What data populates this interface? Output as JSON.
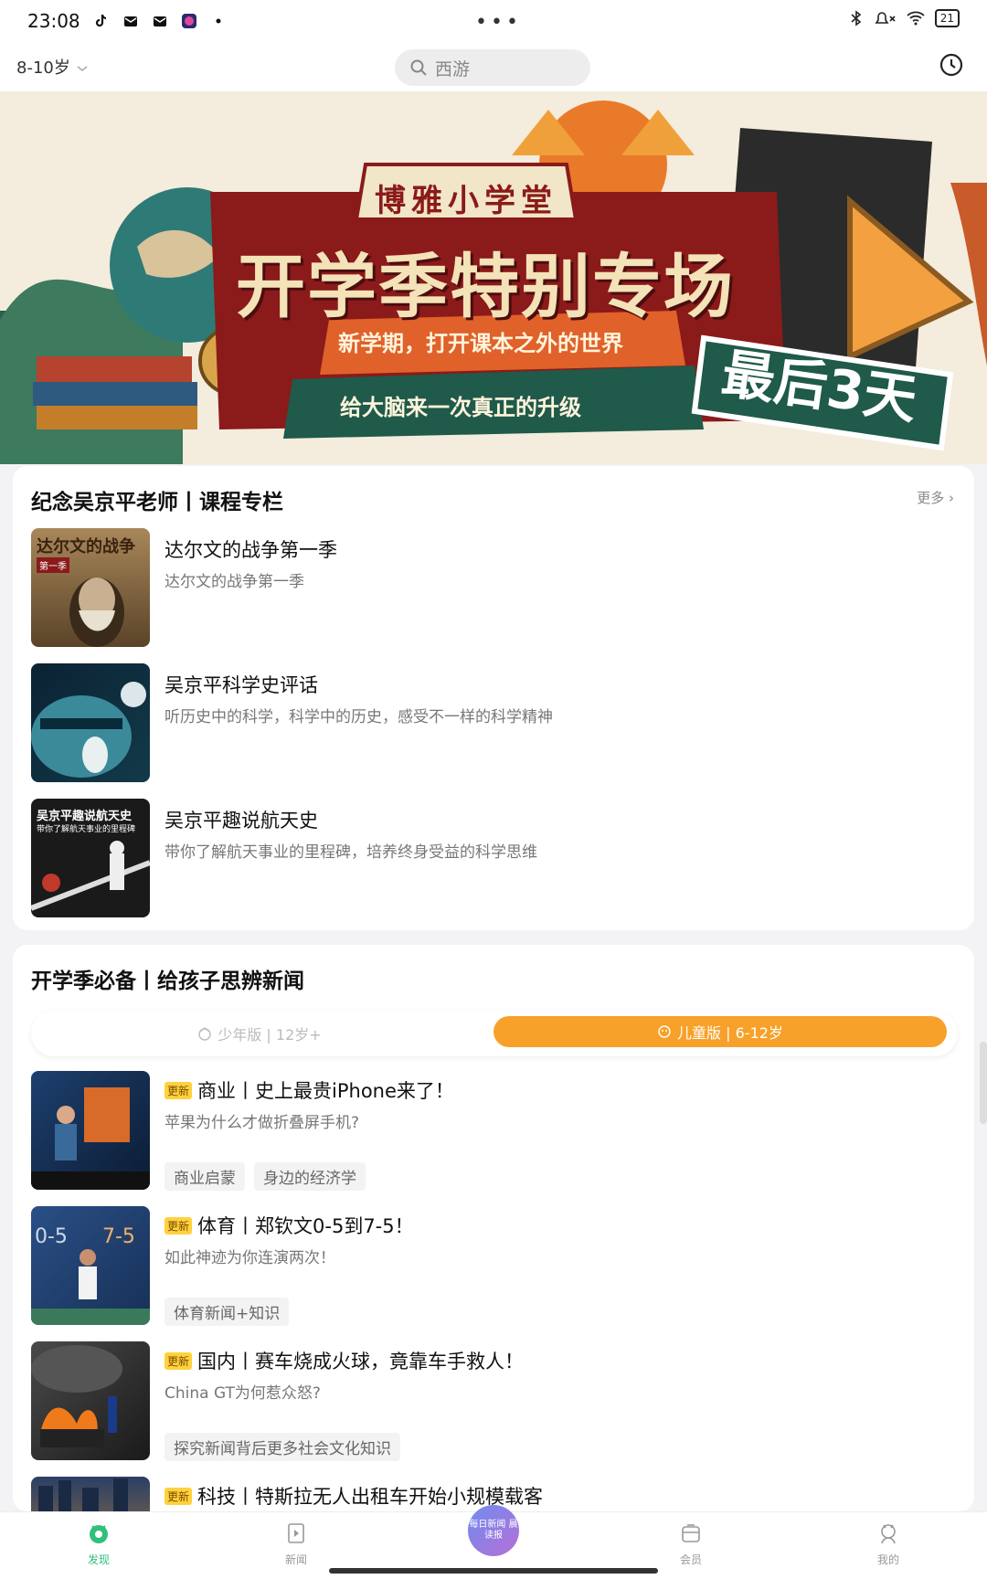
{
  "status_bar": {
    "time": "23:08",
    "dots": "•••",
    "battery": "21"
  },
  "top_bar": {
    "age_label": "8-10岁",
    "search_placeholder": "西游"
  },
  "banner": {
    "subtitle_top": "博雅小学堂",
    "headline": "开学季特别专场",
    "line1": "新学期，打开课本之外的世界",
    "line2": "给大脑来一次真正的升级",
    "badge": "最后3天"
  },
  "course_section": {
    "title": "纪念吴京平老师丨课程专栏",
    "more": "更多",
    "items": [
      {
        "title": "达尔文的战争第一季",
        "subtitle": "达尔文的战争第一季",
        "thumb_text": "达尔文的战争",
        "thumb_sub": "第一季"
      },
      {
        "title": "吴京平科学史评话",
        "subtitle": "听历史中的科学，科学中的历史，感受不一样的科学精神",
        "thumb_text": ""
      },
      {
        "title": "吴京平趣说航天史",
        "subtitle": "带你了解航天事业的里程碑，培养终身受益的科学思维",
        "thumb_text": "吴京平趣说航天史",
        "thumb_sub": "带你了解航天事业的里程碑"
      }
    ]
  },
  "news_section": {
    "title": "开学季必备丨给孩子思辨新闻",
    "tab_left": "少年版 | 12岁+",
    "tab_right": "儿童版 | 6-12岁",
    "items": [
      {
        "badge": "更新",
        "title": "商业丨史上最贵iPhone来了！",
        "subtitle": "苹果为什么才做折叠屏手机?",
        "tags": [
          "商业启蒙",
          "身边的经济学"
        ]
      },
      {
        "badge": "更新",
        "title": "体育丨郑钦文0-5到7-5！",
        "subtitle": "如此神迹为你连演两次！",
        "tags": [
          "体育新闻+知识"
        ]
      },
      {
        "badge": "更新",
        "title": "国内丨赛车烧成火球，竟靠车手救人！",
        "subtitle": "China GT为何惹众怒?",
        "tags": [
          "探究新闻背后更多社会文化知识"
        ]
      },
      {
        "badge": "更新",
        "title": "科技丨特斯拉无人出租车开始小规模载客",
        "subtitle": "",
        "tags": []
      }
    ]
  },
  "bottom_nav": {
    "items": [
      {
        "label": "发现"
      },
      {
        "label": "新闻"
      },
      {
        "label": "每日新闻 晨读报"
      },
      {
        "label": "会员"
      },
      {
        "label": "我的"
      }
    ]
  },
  "colors": {
    "accent": "#f7a12a",
    "active": "#2fc07a",
    "banner_red": "#8b1a1a",
    "banner_green": "#1f5a4a"
  }
}
